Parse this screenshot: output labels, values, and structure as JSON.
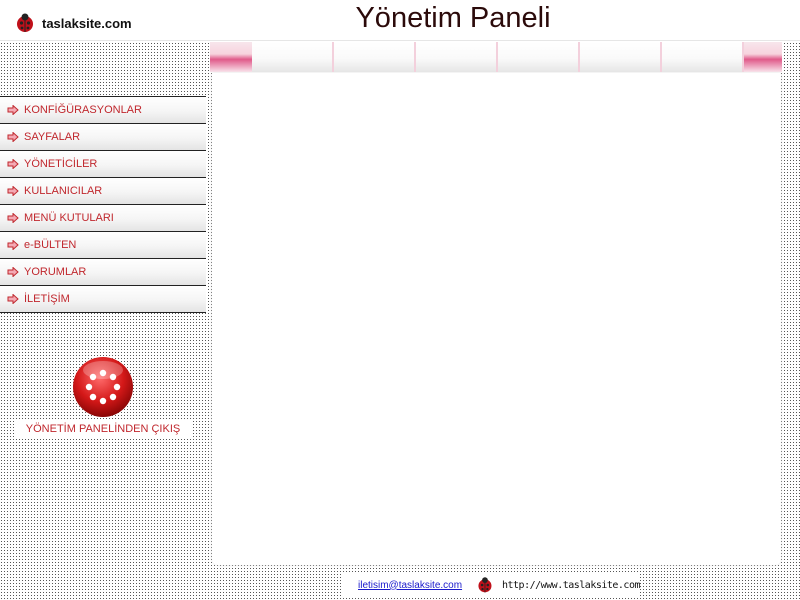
{
  "header": {
    "logo_text": "taslaksite.com",
    "title": "Yönetim Paneli"
  },
  "sidebar": {
    "items": [
      {
        "label": "KONFİĞÜRASYONLAR"
      },
      {
        "label": "SAYFALAR"
      },
      {
        "label": "YÖNETİCİLER"
      },
      {
        "label": "KULLANICILAR"
      },
      {
        "label": "MENÜ KUTULARI"
      },
      {
        "label": "e-BÜLTEN"
      },
      {
        "label": "YORUMLAR"
      },
      {
        "label": "İLETİŞİM"
      }
    ],
    "logout_label": "YÖNETİM PANELİNDEN ÇIKIŞ"
  },
  "footer": {
    "email": "iletisim@taslaksite.com",
    "url": "http://www.taslaksite.com"
  },
  "colors": {
    "accent": "#c0272d",
    "pink": "#e05a8a",
    "title": "#2b0a0a"
  },
  "icons": {
    "logo": "ladybug-icon",
    "menu_item": "arrow-right-icon",
    "logout": "power-logout-icon"
  }
}
